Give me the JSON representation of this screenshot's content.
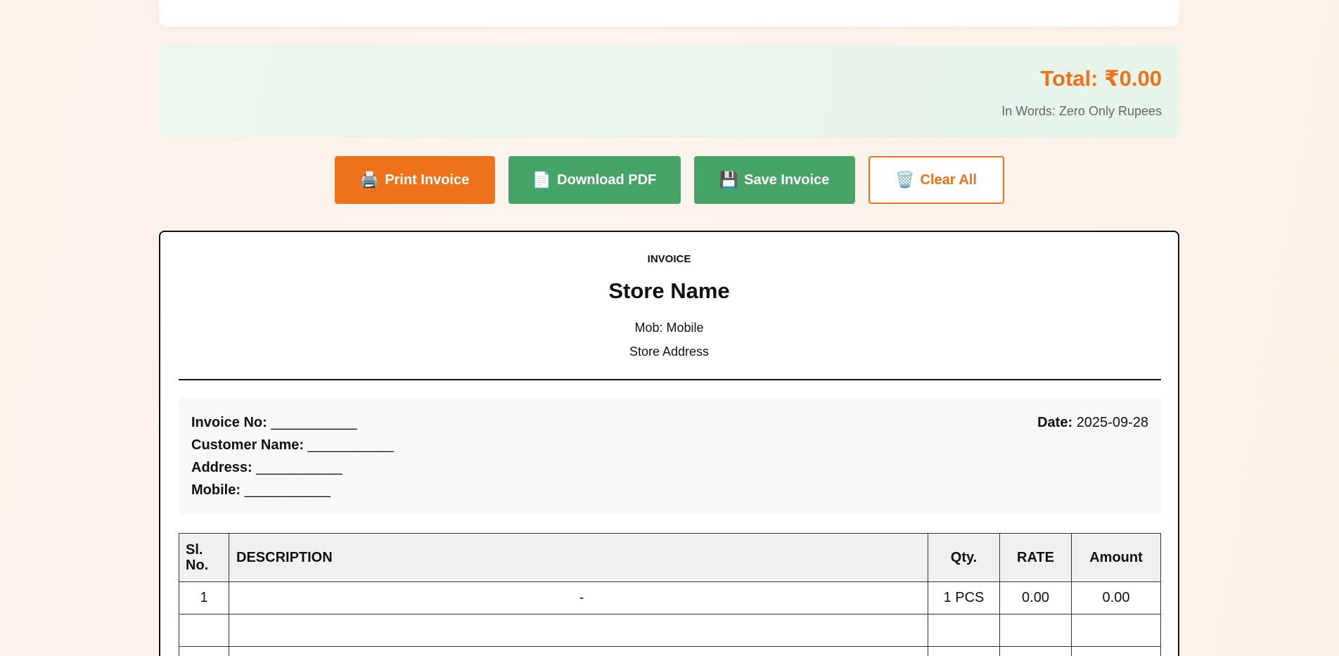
{
  "summary": {
    "total": "Total: ₹0.00",
    "in_words": "In Words: Zero Only Rupees"
  },
  "actions": {
    "print": {
      "icon": "🖨️",
      "label": "Print Invoice"
    },
    "pdf": {
      "icon": "📄",
      "label": "Download PDF"
    },
    "save": {
      "icon": "💾",
      "label": "Save Invoice"
    },
    "clear": {
      "icon": "🗑️",
      "label": "Clear All"
    }
  },
  "invoice": {
    "heading": "INVOICE",
    "store_name": "Store Name",
    "mobile": "Mob: Mobile",
    "address": "Store Address",
    "fields": {
      "invoice_no_label": "Invoice No:",
      "invoice_no_value": "___________",
      "customer_label": "Customer Name:",
      "customer_value": "___________",
      "address_label": "Address:",
      "address_value": "___________",
      "mobile_label": "Mobile:",
      "mobile_value": "___________",
      "date_label": "Date:",
      "date_value": "2025-09-28"
    },
    "table": {
      "headers": {
        "sl_line1": "Sl.",
        "sl_line2": "No.",
        "description": "DESCRIPTION",
        "qty": "Qty.",
        "rate": "RATE",
        "amount": "Amount"
      },
      "rows": [
        {
          "sl": "1",
          "description": "-",
          "qty": "1 PCS",
          "rate": "0.00",
          "amount": "0.00"
        },
        {
          "sl": "",
          "description": "",
          "qty": "",
          "rate": "",
          "amount": ""
        },
        {
          "sl": "",
          "description": "",
          "qty": "",
          "rate": "",
          "amount": ""
        }
      ]
    }
  },
  "colors": {
    "accent": "#ee7219",
    "success": "#46a566"
  }
}
